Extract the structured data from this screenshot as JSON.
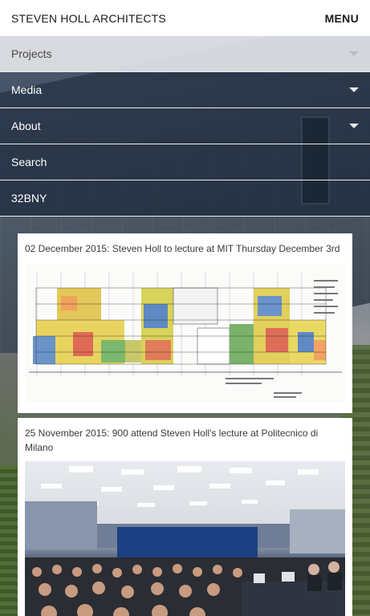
{
  "header": {
    "brand": "STEVEN HOLL ARCHITECTS",
    "menu_label": "MENU"
  },
  "nav": {
    "items": [
      {
        "label": "Projects",
        "has_caret": true,
        "state": "active"
      },
      {
        "label": "Media",
        "has_caret": true,
        "state": "default"
      },
      {
        "label": "About",
        "has_caret": true,
        "state": "default"
      },
      {
        "label": "Search",
        "has_caret": false,
        "state": "default"
      },
      {
        "label": "32BNY",
        "has_caret": false,
        "state": "default"
      }
    ]
  },
  "news": [
    {
      "title": "02 December 2015: Steven Holl to lecture at MIT Thursday December 3rd",
      "image": "floor-plan-drawing"
    },
    {
      "title": "25 November 2015: 900 attend Steven Holl's lecture at Politecnico di Milano",
      "image": "lecture-hall-photo"
    }
  ],
  "colors": {
    "header_bg": "#ffffff",
    "nav_active_bg": "#dadce0",
    "nav_dark_bg": "#142034",
    "text_dark": "#1b1b1b"
  }
}
